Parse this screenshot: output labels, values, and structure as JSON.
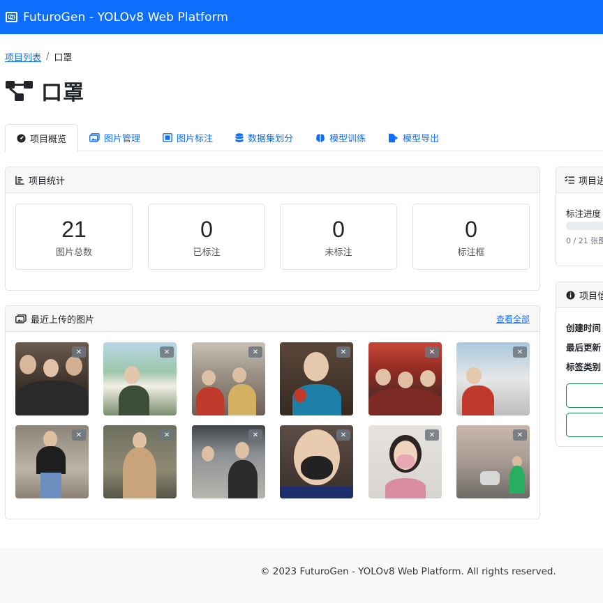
{
  "app": {
    "title": "FuturoGen - YOLOv8 Web Platform"
  },
  "breadcrumb": {
    "parent": "项目列表",
    "current": "口罩"
  },
  "page": {
    "title": "口罩"
  },
  "tabs": [
    {
      "label": "项目概览",
      "icon": "dashboard-icon",
      "active": true
    },
    {
      "label": "图片管理",
      "icon": "images-icon"
    },
    {
      "label": "图片标注",
      "icon": "bounding-box-icon"
    },
    {
      "label": "数据集划分",
      "icon": "database-icon"
    },
    {
      "label": "模型训练",
      "icon": "brain-icon"
    },
    {
      "label": "模型导出",
      "icon": "file-export-icon"
    }
  ],
  "stats_card": {
    "title": "项目统计",
    "items": [
      {
        "value": "21",
        "label": "图片总数"
      },
      {
        "value": "0",
        "label": "已标注"
      },
      {
        "value": "0",
        "label": "未标注"
      },
      {
        "value": "0",
        "label": "标注框"
      }
    ]
  },
  "recent_card": {
    "title": "最近上传的图片",
    "view_all": "查看全部",
    "delete_glyph": "✕",
    "image_count": 12
  },
  "progress_card": {
    "title": "项目进",
    "label": "标注进度",
    "progress": 0,
    "progress_text": "0 / 21 张图"
  },
  "info_card": {
    "title": "项目信",
    "rows": [
      "创建时间",
      "最后更新",
      "标签类别"
    ]
  },
  "footer": {
    "text": "© 2023 FuturoGen - YOLOv8 Web Platform. All rights reserved."
  },
  "colors": {
    "primary": "#0d6efd",
    "success": "#198754",
    "border": "#dee2e6"
  }
}
